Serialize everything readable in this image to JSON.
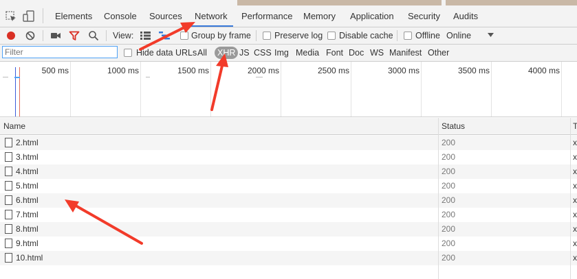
{
  "tabs": [
    {
      "id": "elements",
      "label": "Elements"
    },
    {
      "id": "console",
      "label": "Console"
    },
    {
      "id": "sources",
      "label": "Sources"
    },
    {
      "id": "network",
      "label": "Network"
    },
    {
      "id": "performance",
      "label": "Performance"
    },
    {
      "id": "memory",
      "label": "Memory"
    },
    {
      "id": "application",
      "label": "Application"
    },
    {
      "id": "security",
      "label": "Security"
    },
    {
      "id": "audits",
      "label": "Audits"
    }
  ],
  "active_tab": "Network",
  "toolbar": {
    "view_label": "View:",
    "group_by_frame": "Group by frame",
    "preserve_log": "Preserve log",
    "disable_cache": "Disable cache",
    "offline": "Offline",
    "throttle": "Online"
  },
  "filterbar": {
    "placeholder": "Filter",
    "hide_data_urls": "Hide data URLs",
    "types": [
      "All",
      "XHR",
      "JS",
      "CSS",
      "Img",
      "Media",
      "Font",
      "Doc",
      "WS",
      "Manifest",
      "Other"
    ],
    "selected_type": "XHR"
  },
  "overview": {
    "ticks": [
      "500 ms",
      "1000 ms",
      "1500 ms",
      "2000 ms",
      "2500 ms",
      "3000 ms",
      "3500 ms",
      "4000 ms"
    ]
  },
  "table": {
    "headers": {
      "name": "Name",
      "status": "Status",
      "type": "T"
    },
    "rows": [
      {
        "name": "2.html",
        "status": "200",
        "type": "x"
      },
      {
        "name": "3.html",
        "status": "200",
        "type": "x"
      },
      {
        "name": "4.html",
        "status": "200",
        "type": "x"
      },
      {
        "name": "5.html",
        "status": "200",
        "type": "x"
      },
      {
        "name": "6.html",
        "status": "200",
        "type": "x"
      },
      {
        "name": "7.html",
        "status": "200",
        "type": "x"
      },
      {
        "name": "8.html",
        "status": "200",
        "type": "x"
      },
      {
        "name": "9.html",
        "status": "200",
        "type": "x"
      },
      {
        "name": "10.html",
        "status": "200",
        "type": "x"
      }
    ]
  },
  "colors": {
    "accent": "#3879d9",
    "record": "#d93025",
    "filter_active": "#d93025",
    "annotation": "#f23b2a"
  }
}
